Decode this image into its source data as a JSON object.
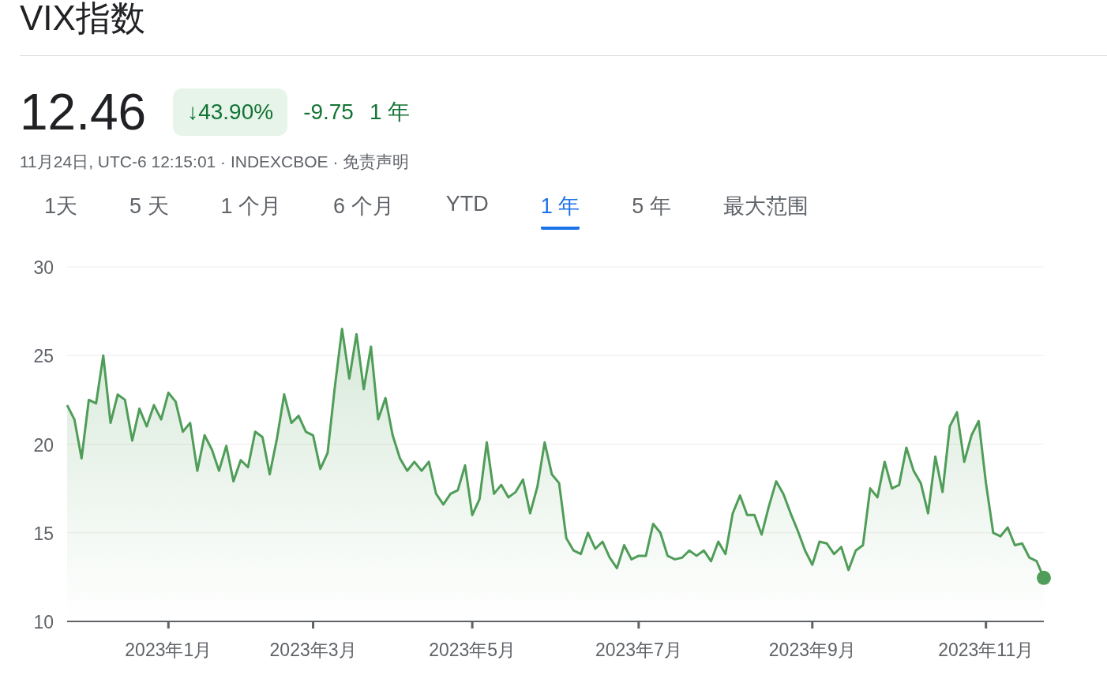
{
  "title": "VIX指数",
  "quote": {
    "price": "12.46",
    "percent_change": "↓43.90%",
    "change": "-9.75",
    "period": "1 年"
  },
  "meta": {
    "text": "11月24日, UTC-6 12:15:01 · INDEXCBOE ·",
    "disclaimer": "免责声明"
  },
  "tabs": [
    {
      "label": "1天",
      "selected": false
    },
    {
      "label": "5 天",
      "selected": false
    },
    {
      "label": "1 个月",
      "selected": false
    },
    {
      "label": "6 个月",
      "selected": false
    },
    {
      "label": "YTD",
      "selected": false
    },
    {
      "label": "1 年",
      "selected": true
    },
    {
      "label": "5 年",
      "selected": false
    },
    {
      "label": "最大范围",
      "selected": false
    }
  ],
  "chart": {
    "chart_data": {
      "type": "area",
      "grid": true,
      "ylim": [
        10,
        30
      ],
      "yticks": [
        10,
        15,
        20,
        25,
        30
      ],
      "categories": [
        null,
        null,
        null,
        null,
        null,
        null,
        null,
        null,
        null,
        null,
        null,
        null,
        null,
        null,
        "2023年1月",
        null,
        null,
        null,
        null,
        null,
        null,
        null,
        null,
        null,
        null,
        null,
        null,
        null,
        null,
        null,
        null,
        null,
        null,
        null,
        "2023年3月",
        null,
        null,
        null,
        null,
        null,
        null,
        null,
        null,
        null,
        null,
        null,
        null,
        null,
        null,
        null,
        null,
        null,
        null,
        null,
        null,
        null,
        "2023年5月",
        null,
        null,
        null,
        null,
        null,
        null,
        null,
        null,
        null,
        null,
        null,
        null,
        null,
        null,
        null,
        null,
        null,
        null,
        null,
        null,
        null,
        null,
        "2023年7月",
        null,
        null,
        null,
        null,
        null,
        null,
        null,
        null,
        null,
        null,
        null,
        null,
        null,
        null,
        null,
        null,
        null,
        null,
        null,
        null,
        null,
        null,
        null,
        "2023年9月",
        null,
        null,
        null,
        null,
        null,
        null,
        null,
        null,
        null,
        null,
        null,
        null,
        null,
        null,
        null,
        null,
        null,
        null,
        null,
        null,
        null,
        null,
        null,
        "2023年11月",
        null,
        null,
        null,
        null,
        null,
        null,
        null,
        null
      ],
      "series": [
        {
          "color": "#4f9d58",
          "values": [
            22.2,
            21.4,
            19.2,
            22.5,
            22.3,
            25.0,
            21.2,
            22.8,
            22.5,
            20.2,
            22.0,
            21.0,
            22.2,
            21.4,
            22.9,
            22.4,
            20.7,
            21.2,
            18.5,
            20.5,
            19.7,
            18.5,
            19.9,
            17.9,
            19.1,
            18.7,
            20.7,
            20.4,
            18.3,
            20.3,
            22.8,
            21.2,
            21.6,
            20.7,
            20.5,
            18.6,
            19.5,
            23.2,
            26.5,
            23.7,
            26.2,
            23.1,
            25.5,
            21.4,
            22.6,
            20.5,
            19.2,
            18.5,
            19.0,
            18.5,
            19.0,
            17.2,
            16.6,
            17.2,
            17.4,
            18.8,
            16.0,
            16.9,
            20.1,
            17.2,
            17.7,
            17.0,
            17.3,
            18.0,
            16.1,
            17.6,
            20.1,
            18.3,
            17.8,
            14.7,
            14.0,
            13.8,
            15.0,
            14.1,
            14.5,
            13.6,
            13.0,
            14.3,
            13.5,
            13.7,
            13.7,
            15.5,
            15.0,
            13.7,
            13.5,
            13.6,
            14.0,
            13.7,
            14.0,
            13.4,
            14.5,
            13.8,
            16.1,
            17.1,
            16.0,
            16.0,
            14.9,
            16.5,
            17.9,
            17.2,
            16.1,
            15.1,
            14.0,
            13.2,
            14.5,
            14.4,
            13.8,
            14.2,
            12.9,
            14.0,
            14.3,
            17.5,
            17.0,
            19.0,
            17.5,
            17.7,
            19.8,
            18.5,
            17.8,
            16.1,
            19.3,
            17.3,
            21.0,
            21.8,
            19.0,
            20.5,
            21.3,
            17.8,
            15.0,
            14.8,
            15.3,
            14.3,
            14.4,
            13.6,
            13.4,
            12.46
          ]
        }
      ]
    }
  }
}
